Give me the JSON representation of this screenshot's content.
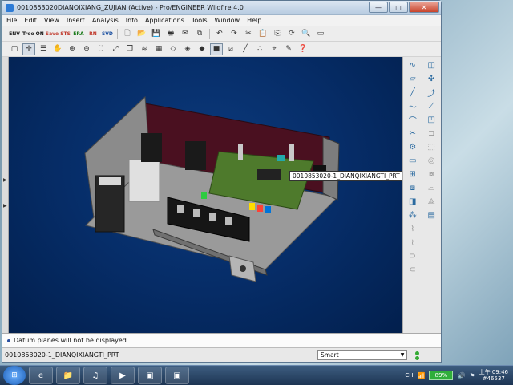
{
  "window": {
    "title": "0010853020DIANQIXIANG_ZUJIAN (Active) - Pro/ENGINEER Wildfire 4.0",
    "controls": {
      "minimize": "—",
      "maximize": "□",
      "close": "✕"
    }
  },
  "menu": [
    "File",
    "Edit",
    "View",
    "Insert",
    "Analysis",
    "Info",
    "Applications",
    "Tools",
    "Window",
    "Help"
  ],
  "toolbar": {
    "mode_buttons": [
      {
        "label": "ENV",
        "color": "#1a1a1a"
      },
      {
        "label": "Tree ON",
        "color": "#1a1a1a"
      },
      {
        "label": "Save STS",
        "color": "#c0392b"
      },
      {
        "label": "ERA",
        "color": "#1b7a1b"
      },
      {
        "label": "RN",
        "color": "#c0392b"
      },
      {
        "label": "SVD",
        "color": "#1a4fa0"
      }
    ],
    "icons_row1": [
      "new-icon",
      "open-icon",
      "save-icon",
      "print-icon",
      "email-icon",
      "copy-icon",
      "undo-icon",
      "redo-icon",
      "cut-icon",
      "copy-icon",
      "paste-icon",
      "paste-special-icon",
      "regenerate-icon",
      "find-icon",
      "select-box-icon"
    ],
    "icons_row2": [
      "repaint-icon",
      "spin-center-icon",
      "orient-icon",
      "zoom-in-icon",
      "zoom-out-icon",
      "refit-icon",
      "reorient-icon",
      "saved-views-icon",
      "layers-icon",
      "view-manager-icon",
      "wireframe-icon",
      "hidden-line-icon",
      "no-hidden-icon",
      "shading-icon",
      "datum-planes-icon",
      "datum-axes-icon",
      "datum-points-icon",
      "coord-sys-icon",
      "annotations-icon",
      "help-context-icon"
    ]
  },
  "right_toolbar": {
    "col1": [
      "datum-curve-icon",
      "sketch-icon",
      "line-icon",
      "spline-icon",
      "arc-icon",
      "trim-icon",
      "fastener-icon",
      "component-icon",
      "insert-icon",
      "mirror-icon",
      "assembly-icon",
      "pattern-icon",
      "cable-icon",
      "spring-icon",
      "harness-icon",
      "wire-icon"
    ],
    "col2": [
      "plane-icon",
      "axis-icon",
      "point-icon",
      "csys-icon",
      "datum-analysis-icon",
      "sketch-tool-icon",
      "extrude-icon",
      "revolve-icon",
      "blend-icon",
      "round-icon",
      "chamfer-icon",
      "table-icon"
    ]
  },
  "viewport": {
    "tooltip": "0010853020-1_DIANQIXIANGTI_PRT",
    "background": "#062d68"
  },
  "message": "Datum planes will not be displayed.",
  "status": {
    "selection": "0010853020-1_DIANQIXIANGTI_PRT",
    "filter": "Smart"
  },
  "taskbar": {
    "apps": [
      "ie-icon",
      "explorer-icon",
      "media-icon",
      "player-icon",
      "proe-icon",
      "proe2-icon"
    ],
    "language": "CH",
    "battery": "89%",
    "clock_line1": "上午 09:46",
    "clock_line2": "#46537"
  }
}
